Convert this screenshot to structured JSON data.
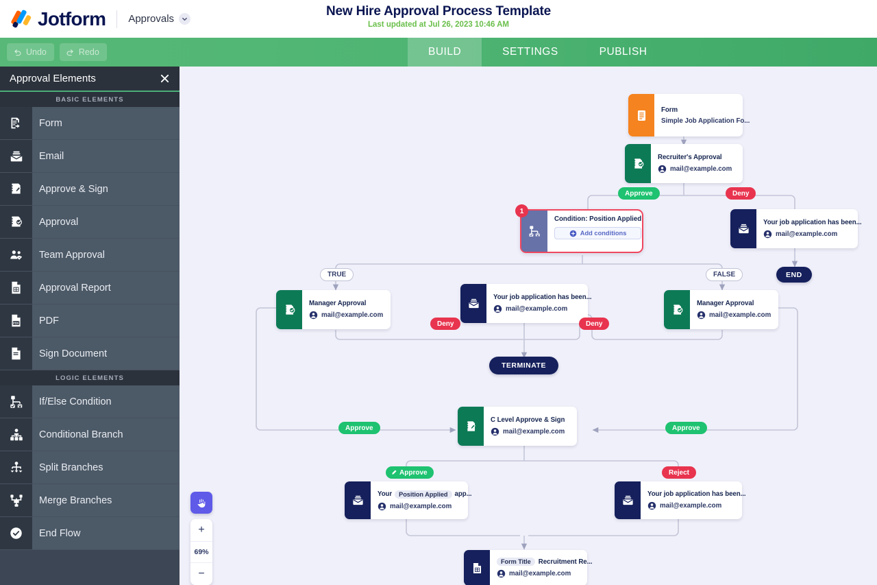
{
  "header": {
    "brand": "Jotform",
    "product": "Approvals",
    "product_chevron_icon": "chevron-down-icon",
    "title": "New Hire Approval Process Template",
    "subtitle": "Last updated at Jul 26, 2023 10:46 AM",
    "accent_green": "#4fb573",
    "subtitle_color": "#6abf4b"
  },
  "toolbar": {
    "undo_label": "Undo",
    "redo_label": "Redo",
    "tabs": [
      {
        "label": "BUILD",
        "active": true
      },
      {
        "label": "SETTINGS",
        "active": false
      },
      {
        "label": "PUBLISH",
        "active": false
      }
    ]
  },
  "sidebar": {
    "title": "Approval Elements",
    "close_icon": "close-icon",
    "sections": [
      {
        "label": "BASIC ELEMENTS",
        "items": [
          {
            "label": "Form",
            "icon": "form-icon"
          },
          {
            "label": "Email",
            "icon": "email-icon"
          },
          {
            "label": "Approve & Sign",
            "icon": "approve-sign-icon"
          },
          {
            "label": "Approval",
            "icon": "approval-icon"
          },
          {
            "label": "Team Approval",
            "icon": "team-approval-icon"
          },
          {
            "label": "Approval Report",
            "icon": "approval-report-icon"
          },
          {
            "label": "PDF",
            "icon": "pdf-icon"
          },
          {
            "label": "Sign Document",
            "icon": "sign-document-icon"
          }
        ]
      },
      {
        "label": "LOGIC ELEMENTS",
        "items": [
          {
            "label": "If/Else Condition",
            "icon": "if-else-condition-icon"
          },
          {
            "label": "Conditional Branch",
            "icon": "conditional-branch-icon"
          },
          {
            "label": "Split Branches",
            "icon": "split-branches-icon"
          },
          {
            "label": "Merge Branches",
            "icon": "merge-branches-icon"
          },
          {
            "label": "End Flow",
            "icon": "end-flow-icon"
          }
        ]
      }
    ]
  },
  "canvas": {
    "background": "#f0f0fa",
    "edge_color": "#c4c6d8",
    "nodes": {
      "form": {
        "type": "form",
        "title": "Form",
        "subtitle": "Simple Job Application Fo...",
        "color": "#f5831f",
        "icon": "form-icon"
      },
      "recruiter": {
        "type": "approval",
        "title": "Recruiter's Approval",
        "subtitle": "mail@example.com",
        "color": "#0d7a56",
        "icon": "approval-icon"
      },
      "condition": {
        "type": "condition",
        "title": "Condition: Position Applied",
        "button": "Add conditions",
        "badge": "1",
        "color": "#6672a8",
        "border": "#f0475f",
        "icon": "if-else-condition-icon"
      },
      "deny_email_top": {
        "type": "email",
        "title": "Your job application has been...",
        "subtitle": "mail@example.com",
        "color": "#15205c",
        "icon": "email-icon"
      },
      "end": {
        "label": "END"
      },
      "manager_left": {
        "type": "approval",
        "title": "Manager Approval",
        "subtitle": "mail@example.com",
        "color": "#0d7a56",
        "icon": "approval-icon"
      },
      "deny_email_mid": {
        "type": "email",
        "title": "Your job application has been...",
        "subtitle": "mail@example.com",
        "color": "#15205c",
        "icon": "email-icon"
      },
      "manager_right": {
        "type": "approval",
        "title": "Manager Approval",
        "subtitle": "mail@example.com",
        "color": "#0d7a56",
        "icon": "approval-icon"
      },
      "terminate": {
        "label": "TERMINATE"
      },
      "c_level": {
        "type": "approve-sign",
        "title": "C Level Approve & Sign",
        "subtitle": "mail@example.com",
        "color": "#0d7a56",
        "icon": "approve-sign-icon"
      },
      "accept_email": {
        "type": "email",
        "title_pre": "Your",
        "title_chip": "Position Applied",
        "title_post": "app...",
        "subtitle": "mail@example.com",
        "color": "#15205c",
        "icon": "email-icon"
      },
      "reject_email": {
        "type": "email",
        "title": "Your job application has been...",
        "subtitle": "mail@example.com",
        "color": "#15205c",
        "icon": "email-icon"
      },
      "report": {
        "type": "approval-report",
        "title_chip": "Form Title",
        "title_post": "Recruitment Re...",
        "subtitle": "mail@example.com",
        "color": "#15205c",
        "icon": "approval-report-icon"
      }
    },
    "edge_labels": {
      "approve_top": "Approve",
      "deny_top": "Deny",
      "true": "TRUE",
      "false": "FALSE",
      "deny_left": "Deny",
      "deny_right": "Deny",
      "approve_left": "Approve",
      "approve_right": "Approve",
      "approve_sign": "Approve",
      "reject": "Reject"
    },
    "approve_color": "#1ec270",
    "deny_color": "#e8344e"
  },
  "zoom_controls": {
    "hand_icon": "hand-tool-icon",
    "zoom_in": "+",
    "level": "69%",
    "zoom_out": "−",
    "hand_color": "#5f5ae8"
  }
}
